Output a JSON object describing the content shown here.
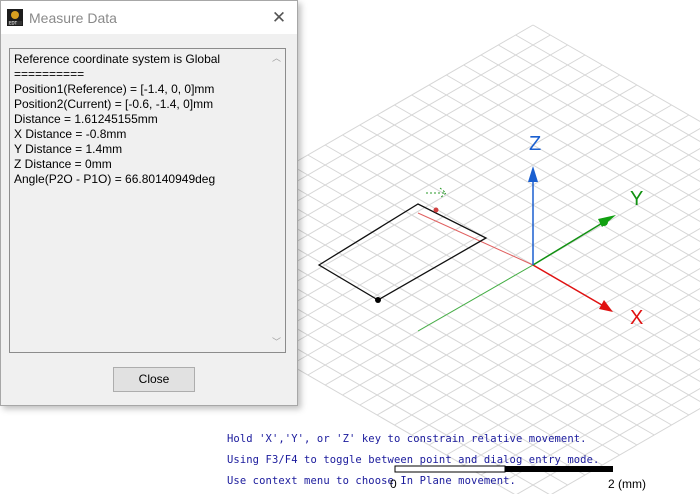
{
  "dialog": {
    "title": "Measure Data",
    "lines": [
      "Reference coordinate system is Global",
      "==========",
      "Position1(Reference) = [-1.4, 0, 0]mm",
      "Position2(Current) = [-0.6, -1.4, 0]mm",
      "Distance = 1.61245155mm",
      "X Distance = -0.8mm",
      "Y Distance = 1.4mm",
      "Z Distance = 0mm",
      "Angle(P2O - P1O) = 66.80140949deg"
    ],
    "close_button_label": "Close"
  },
  "viewport": {
    "axes": {
      "x": "X",
      "y": "Y",
      "z": "Z"
    },
    "triad": {
      "x": "X",
      "y": "Y"
    },
    "hints": [
      "Hold 'X','Y', or 'Z' key to constrain relative movement.",
      "Using F3/F4 to toggle between point and dialog entry mode.",
      "Use context menu to choose In Plane movement."
    ],
    "scale": {
      "start": "0",
      "end": "2 (mm)"
    },
    "colors": {
      "x_axis": "#e01010",
      "y_axis": "#119111",
      "z_axis": "#1a5fd0",
      "hint_text": "#1a1a9c"
    }
  }
}
